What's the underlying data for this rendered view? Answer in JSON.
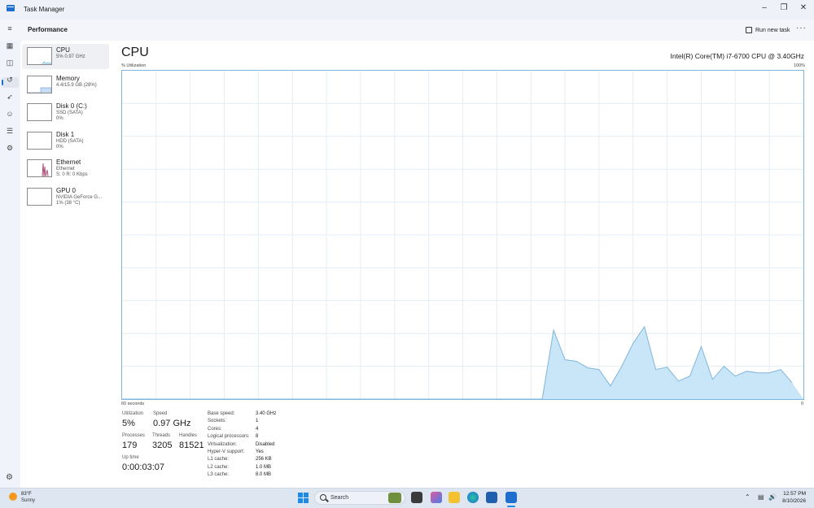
{
  "window": {
    "title": "Task Manager"
  },
  "header": {
    "page_title": "Performance",
    "run_new_task": "Run new task",
    "more": "···"
  },
  "nav": [
    {
      "name": "menu-icon",
      "glyph": "≡"
    },
    {
      "name": "processes-icon",
      "glyph": "▦"
    },
    {
      "name": "performance-icon",
      "glyph": "◫"
    },
    {
      "name": "app-history-icon",
      "glyph": "↺"
    },
    {
      "name": "startup-apps-icon",
      "glyph": "➶"
    },
    {
      "name": "users-icon",
      "glyph": "☺"
    },
    {
      "name": "details-icon",
      "glyph": "☰"
    },
    {
      "name": "services-icon",
      "glyph": "⚙"
    }
  ],
  "resources": [
    {
      "name": "CPU",
      "sub1": "5% 0.97 GHz",
      "sub2": ""
    },
    {
      "name": "Memory",
      "sub1": "4.4/15.9 GB (28%)",
      "sub2": ""
    },
    {
      "name": "Disk 0 (C:)",
      "sub1": "SSD (SATA)",
      "sub2": "0%"
    },
    {
      "name": "Disk 1",
      "sub1": "HDD (SATA)",
      "sub2": "0%"
    },
    {
      "name": "Ethernet",
      "sub1": "Ethernet",
      "sub2": "S: 0 R: 0 Kbps"
    },
    {
      "name": "GPU 0",
      "sub1": "NVIDIA GeForce G...",
      "sub2": "1% (38 °C)"
    }
  ],
  "cpu": {
    "title": "CPU",
    "model": "Intel(R) Core(TM) i7-6700 CPU @ 3.40GHz",
    "y_label": "% Utilization",
    "y_max": "100%",
    "x_left": "60 seconds",
    "x_right": "0"
  },
  "chart_data": {
    "type": "area",
    "title": "CPU",
    "ylabel": "% Utilization",
    "xlabel": "60 seconds",
    "ylim": [
      0,
      100
    ],
    "x": [
      60,
      59,
      58,
      57,
      56,
      55,
      54,
      53,
      52,
      51,
      50,
      49,
      48,
      47,
      46,
      45,
      44,
      43,
      42,
      41,
      40,
      39,
      38,
      37,
      36,
      35,
      34,
      33,
      32,
      31,
      30,
      29,
      28,
      27,
      26,
      25,
      24,
      23,
      22,
      21,
      20,
      19,
      18,
      17,
      16,
      15,
      14,
      13,
      12,
      11,
      10,
      9,
      8,
      7,
      6,
      5,
      4,
      3,
      2,
      1,
      0
    ],
    "values": [
      0,
      0,
      0,
      0,
      0,
      0,
      0,
      0,
      0,
      0,
      0,
      0,
      0,
      0,
      0,
      0,
      0,
      0,
      0,
      0,
      0,
      0,
      0,
      0,
      0,
      0,
      0,
      0,
      0,
      0,
      0,
      0,
      0,
      0,
      0,
      0,
      0,
      0,
      21,
      12,
      11.5,
      9.5,
      9,
      4,
      10,
      17,
      22,
      9,
      9.7,
      5.5,
      7,
      16,
      6,
      10,
      7,
      8.5,
      8,
      8,
      9,
      5
    ],
    "series": [
      {
        "color": "#7fb6dd",
        "fill": "#c8e6f7"
      }
    ],
    "grid": true
  },
  "stats": {
    "utilization_label": "Utilization",
    "utilization": "5%",
    "speed_label": "Speed",
    "speed": "0.97 GHz",
    "processes_label": "Processes",
    "processes": "179",
    "threads_label": "Threads",
    "threads": "3205",
    "handles_label": "Handles",
    "handles": "81521",
    "uptime_label": "Up time",
    "uptime": "0:00:03:07"
  },
  "specs": [
    {
      "k": "Base speed:",
      "v": "3.40 GHz"
    },
    {
      "k": "Sockets:",
      "v": "1"
    },
    {
      "k": "Cores:",
      "v": "4"
    },
    {
      "k": "Logical processors:",
      "v": "8"
    },
    {
      "k": "Virtualization:",
      "v": "Disabled"
    },
    {
      "k": "Hyper-V support:",
      "v": "Yes"
    },
    {
      "k": "L1 cache:",
      "v": "256 KB"
    },
    {
      "k": "L2 cache:",
      "v": "1.0 MB"
    },
    {
      "k": "L3 cache:",
      "v": "8.0 MB"
    }
  ],
  "taskbar": {
    "weather_temp": "83°F",
    "weather_desc": "Sunny",
    "search": "Search",
    "time": "12:57 PM",
    "date": "8/10/2026"
  }
}
